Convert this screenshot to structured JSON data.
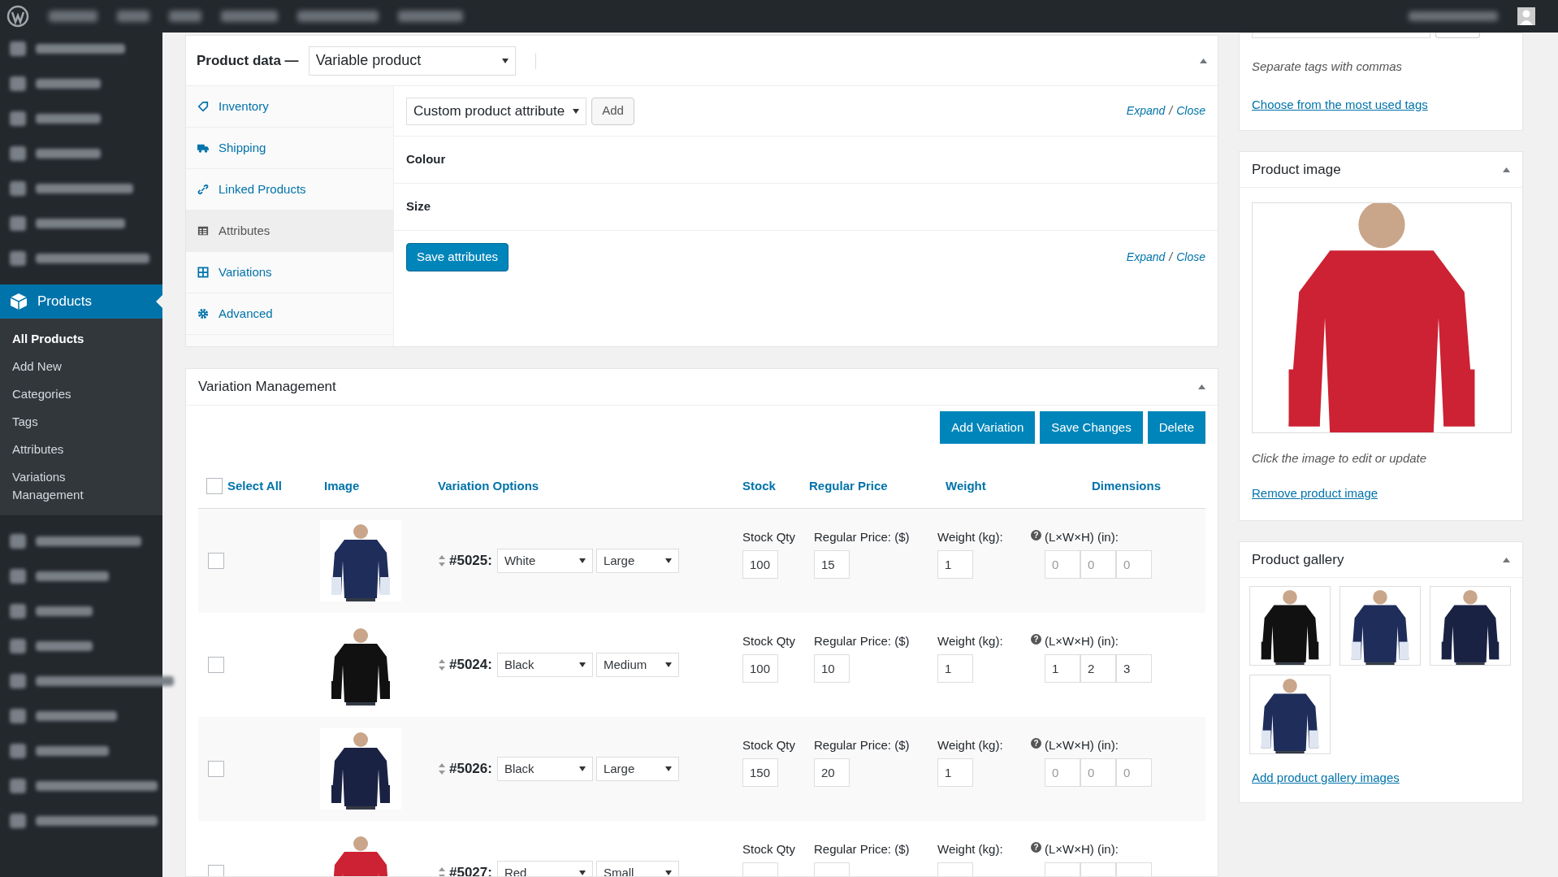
{
  "sidebar": {
    "current": {
      "label": "Products"
    },
    "submenu": [
      {
        "label": "All Products",
        "selected": true
      },
      {
        "label": "Add New",
        "selected": false
      },
      {
        "label": "Categories",
        "selected": false
      },
      {
        "label": "Tags",
        "selected": false
      },
      {
        "label": "Attributes",
        "selected": false
      },
      {
        "label": "Variations Management",
        "selected": false
      }
    ]
  },
  "product_data": {
    "title": "Product data —",
    "type_select": "Variable product",
    "tabs": [
      {
        "label": "Inventory",
        "selected": false
      },
      {
        "label": "Shipping",
        "selected": false
      },
      {
        "label": "Linked Products",
        "selected": false
      },
      {
        "label": "Attributes",
        "selected": true
      },
      {
        "label": "Variations",
        "selected": false
      },
      {
        "label": "Advanced",
        "selected": false
      }
    ],
    "attribute_select": "Custom product attribute",
    "add_button": "Add",
    "links": [
      {
        "expand": "Expand",
        "separator": "/",
        "close": "Close"
      },
      {
        "expand": "Expand",
        "separator": "/",
        "close": "Close"
      }
    ],
    "attributes": [
      "Colour",
      "Size"
    ],
    "save_button": "Save attributes"
  },
  "variation_management": {
    "title": "Variation Management",
    "buttons": [
      "Add Variation",
      "Save Changes",
      "Delete"
    ],
    "select_all": {
      "label": "Select All",
      "checked": false
    },
    "columns": [
      "Image",
      "Variation Options",
      "Stock",
      "Regular Price",
      "Weight",
      "Dimensions"
    ],
    "rows": [
      {
        "checked": false,
        "id": "#5025:",
        "colour_option": "White",
        "size": "Large",
        "stock_label": "Stock Qty",
        "stock": "100",
        "price_label": "Regular Price: ($)",
        "price": "15",
        "weight_label": "Weight (kg):",
        "weight": "1",
        "help": "?",
        "dims_label": "(L×W×H) (in):",
        "dims": [
          {
            "placeholder": "0"
          },
          {
            "placeholder": "0"
          },
          {
            "placeholder": "0"
          }
        ]
      },
      {
        "checked": false,
        "id": "#5024:",
        "colour_option": "Black",
        "size": "Medium",
        "stock_label": "Stock Qty",
        "stock": "100",
        "price_label": "Regular Price: ($)",
        "price": "10",
        "weight_label": "Weight (kg):",
        "weight": "1",
        "help": "?",
        "dims_label": "(L×W×H) (in):",
        "dims": [
          {
            "value": "1"
          },
          {
            "value": "2"
          },
          {
            "value": "3"
          }
        ]
      },
      {
        "checked": false,
        "id": "#5026:",
        "colour_option": "Black",
        "size": "Large",
        "stock_label": "Stock Qty",
        "stock": "150",
        "price_label": "Regular Price: ($)",
        "price": "20",
        "weight_label": "Weight (kg):",
        "weight": "1",
        "help": "?",
        "dims_label": "(L×W×H) (in):",
        "dims": [
          {
            "placeholder": "0"
          },
          {
            "placeholder": "0"
          },
          {
            "placeholder": "0"
          }
        ]
      },
      {
        "checked": false,
        "id": "#5027:",
        "colour_option": "Red",
        "size": "Small",
        "stock_label": "Stock Qty",
        "price_label": "Regular Price: ($)",
        "weight_label": "Weight (kg):",
        "help": "?",
        "dims_label": "(L×W×H) (in):"
      }
    ]
  },
  "tags_box": {
    "hint": "Separate tags with commas",
    "link": "Choose from the most used tags"
  },
  "product_image": {
    "title": "Product image",
    "hint": "Click the image to edit or update",
    "link": "Remove product image"
  },
  "product_gallery": {
    "title": "Product gallery",
    "link": "Add product gallery images"
  }
}
